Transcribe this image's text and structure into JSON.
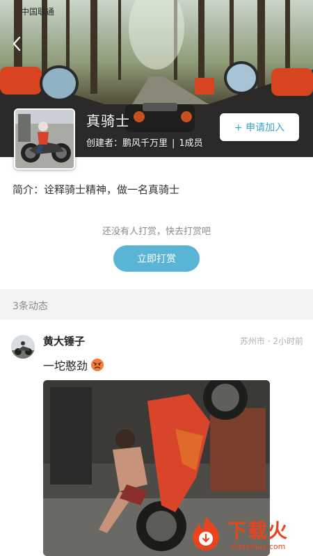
{
  "status_bar": {
    "carrier": "中国联通"
  },
  "group": {
    "name": "真骑士",
    "creator_label": "创建者：鹏风千万里",
    "members": "1成员",
    "join_label": "+ 申请加入",
    "intro": "简介：诠释骑士精神，做一名真骑士"
  },
  "reward": {
    "empty_text": "还没有人打赏，快去打赏吧",
    "button_label": "立即打赏"
  },
  "feed": {
    "count_label": "3条动态",
    "posts": [
      {
        "author": "黄大锤子",
        "meta": "苏州市 · 2小时前",
        "text": "一坨憨劲",
        "emoji": "angry-face-icon"
      }
    ]
  },
  "watermark": {
    "name": "下载火",
    "url": "xiazaihuo.com"
  },
  "colors": {
    "accent": "#5ab4d6",
    "join_text": "#3aa6c9",
    "watermark": "#e8451f"
  }
}
